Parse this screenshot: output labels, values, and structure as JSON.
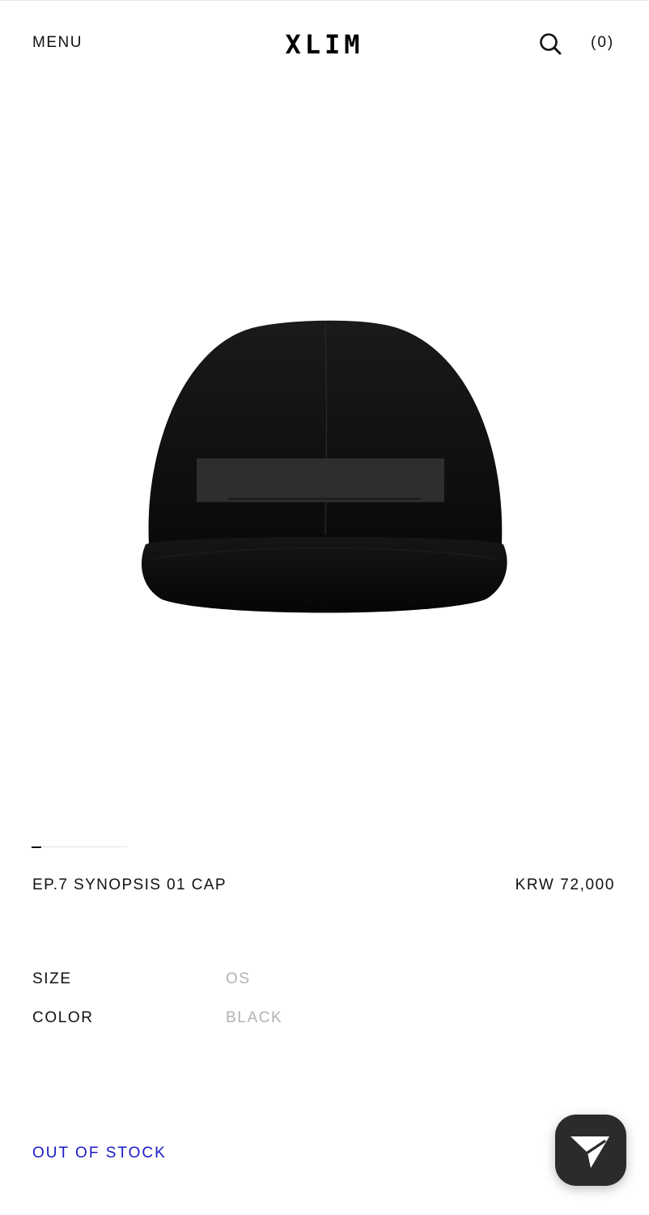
{
  "header": {
    "menu_label": "MENU",
    "logo_text": "XLIM",
    "search_icon": "search-icon",
    "cart_label": "(0)"
  },
  "gallery": {
    "image_subject": "black five-panel cap with tonal patch",
    "slide_current": 1
  },
  "product": {
    "name": "EP.7 SYNOPSIS 01 CAP",
    "price": "KRW 72,000"
  },
  "options": {
    "size_label": "SIZE",
    "size_value": "OS",
    "color_label": "COLOR",
    "color_value": "BLACK"
  },
  "status": {
    "stock_label": "OUT OF STOCK",
    "stock_color": "#1a1ac8"
  },
  "chat": {
    "icon": "send-plane-icon",
    "bg_color": "#2b2b2d"
  }
}
